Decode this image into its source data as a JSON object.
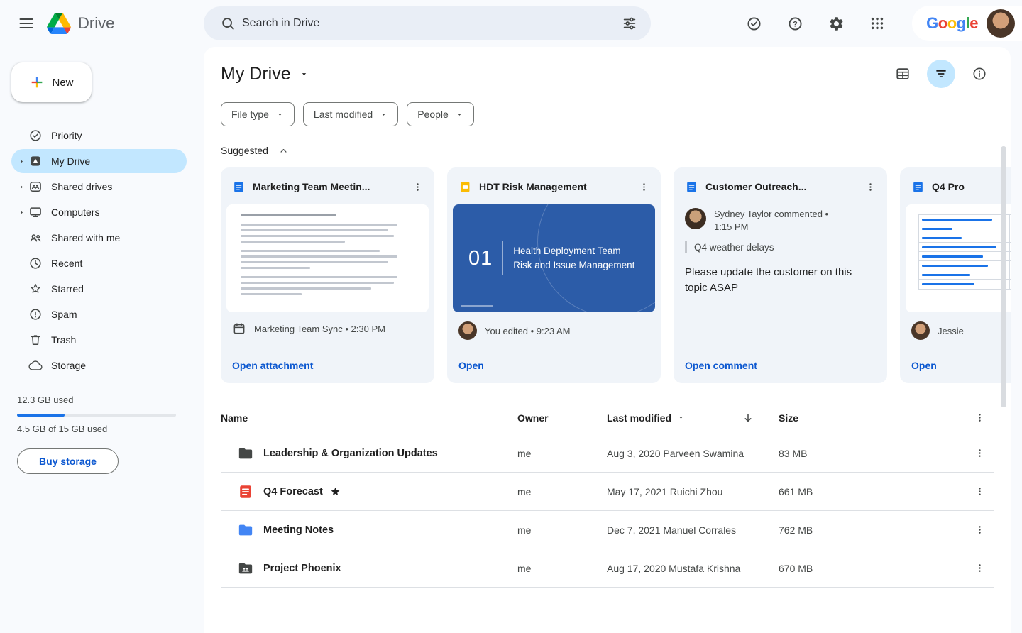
{
  "colors": {
    "accent_blue": "#0B57D0",
    "selected_item_bg": "#C2E7FF",
    "page_bg": "#F8FAFD",
    "card_bg": "#F0F4F9",
    "slide_blue": "#2C5CA8",
    "doc_icon_blue": "#1A73E8",
    "slides_icon_yellow": "#FBBC04",
    "pdf_icon_red": "#EA4335",
    "folder_dark": "#444746",
    "folder_blue": "#4285F4",
    "progress_fill": "#1A73E8"
  },
  "header": {
    "app_name": "Drive",
    "menu_icon": "hamburger-menu-icon",
    "logo_icon": "drive-logo-icon",
    "search": {
      "placeholder": "Search in Drive",
      "left_icon": "search-icon",
      "right_icon": "tune-icon"
    },
    "action_icons": [
      "offline-check-icon",
      "help-icon",
      "settings-gear-icon",
      "apps-grid-icon"
    ],
    "google_wordmark": {
      "letters": [
        "G",
        "o",
        "o",
        "g",
        "l",
        "e"
      ]
    }
  },
  "sidebar": {
    "new_button_label": "New",
    "items": [
      {
        "label": "Priority",
        "icon": "priority-check-icon",
        "selected": false,
        "expandable": false
      },
      {
        "label": "My Drive",
        "icon": "my-drive-icon",
        "selected": true,
        "expandable": true
      },
      {
        "label": "Shared drives",
        "icon": "shared-drives-icon",
        "selected": false,
        "expandable": true
      },
      {
        "label": "Computers",
        "icon": "computers-icon",
        "selected": false,
        "expandable": true
      },
      {
        "label": "Shared with me",
        "icon": "shared-with-me-icon",
        "selected": false,
        "expandable": false
      },
      {
        "label": "Recent",
        "icon": "recent-clock-icon",
        "selected": false,
        "expandable": false
      },
      {
        "label": "Starred",
        "icon": "star-icon",
        "selected": false,
        "expandable": false
      },
      {
        "label": "Spam",
        "icon": "spam-icon",
        "selected": false,
        "expandable": false
      },
      {
        "label": "Trash",
        "icon": "trash-icon",
        "selected": false,
        "expandable": false
      },
      {
        "label": "Storage",
        "icon": "storage-cloud-icon",
        "selected": false,
        "expandable": false
      }
    ],
    "storage": {
      "used_text": "12.3 GB used",
      "progress_percent": 30,
      "quota_text": "4.5 GB of 15 GB used",
      "buy_button_label": "Buy storage"
    }
  },
  "main": {
    "title": "My Drive",
    "toolbar_icons": [
      "grid-view-icon",
      "filter-active-icon",
      "info-icon"
    ],
    "filter_chips": [
      {
        "label": "File type"
      },
      {
        "label": "Last modified"
      },
      {
        "label": "People"
      }
    ],
    "suggested": {
      "label": "Suggested",
      "cards": [
        {
          "file_type": "doc",
          "title": "Marketing Team Meetin...",
          "meta": "Marketing Team Sync • 2:30 PM",
          "meta_icon": "calendar-icon",
          "action": "Open attachment"
        },
        {
          "file_type": "slides",
          "title": "HDT Risk Management",
          "slide": {
            "number": "01",
            "line1": "Health Deployment Team",
            "line2": "Risk and Issue Management"
          },
          "meta": "You edited • 9:23 AM",
          "action": "Open"
        },
        {
          "file_type": "doc",
          "title": "Customer Outreach...",
          "comment": {
            "author_line": "Sydney Taylor commented •",
            "time": "1:15 PM",
            "quote": "Q4 weather delays",
            "message": "Please update the customer on this topic ASAP"
          },
          "action": "Open comment"
        },
        {
          "file_type": "doc",
          "title": "Q4 Pro",
          "meta": "Jessie",
          "action": "Open"
        }
      ]
    },
    "file_table": {
      "headers": {
        "name": "Name",
        "owner": "Owner",
        "last_modified": "Last modified",
        "size": "Size"
      },
      "rows": [
        {
          "icon": "folder-icon",
          "name": "Leadership & Organization Updates",
          "starred": false,
          "owner": "me",
          "last_modified": "Aug 3, 2020 Parveen Swamina",
          "size": "83 MB"
        },
        {
          "icon": "pdf-file-icon",
          "name": "Q4 Forecast",
          "starred": true,
          "owner": "me",
          "last_modified": "May 17, 2021 Ruichi Zhou",
          "size": "661 MB"
        },
        {
          "icon": "folder-blue-icon",
          "name": "Meeting Notes",
          "starred": false,
          "owner": "me",
          "last_modified": "Dec 7, 2021 Manuel Corrales",
          "size": "762 MB"
        },
        {
          "icon": "shared-folder-icon",
          "name": "Project Phoenix",
          "starred": false,
          "owner": "me",
          "last_modified": "Aug 17, 2020 Mustafa Krishna",
          "size": "670 MB"
        }
      ]
    }
  }
}
